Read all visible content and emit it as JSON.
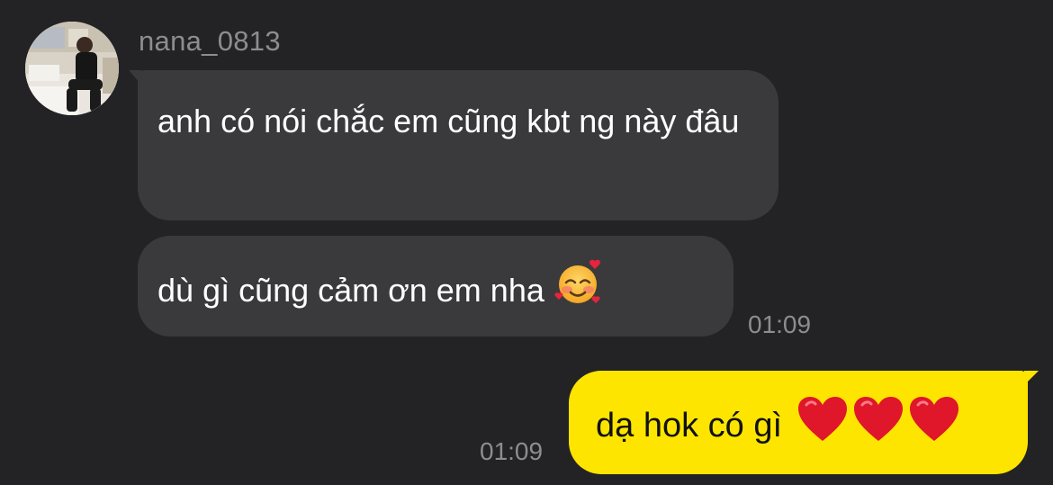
{
  "chat": {
    "sender_name": "nana_0813",
    "messages_in": [
      {
        "text": "anh có nói chắc em cũng kbt ng này đâu"
      },
      {
        "text": "dù gì cũng cảm ơn em nha",
        "emoji": "smiling-face-with-hearts"
      }
    ],
    "time_in": "01:09",
    "message_out": {
      "text": "dạ hok có gì",
      "emojis": [
        "red-heart",
        "red-heart",
        "red-heart"
      ]
    },
    "time_out": "01:09"
  },
  "colors": {
    "background": "#232325",
    "incoming_bubble": "#3a3a3c",
    "outgoing_bubble": "#fee500",
    "meta_text": "#8d8d90"
  }
}
